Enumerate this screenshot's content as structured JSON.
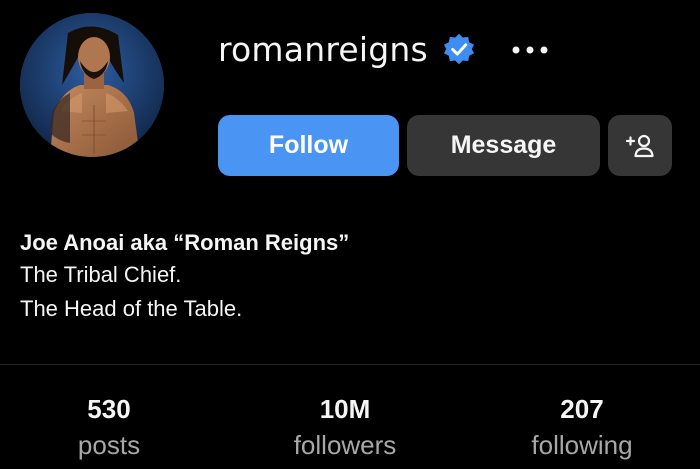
{
  "profile": {
    "username": "romanreigns",
    "verified": true,
    "avatar_icon": "profile-photo",
    "more_icon": "more-options-icon"
  },
  "actions": {
    "follow_label": "Follow",
    "message_label": "Message",
    "suggest_icon": "add-person-icon"
  },
  "bio": {
    "name": "Joe Anoai aka “Roman Reigns”",
    "lines": [
      "The Tribal Chief.",
      "The Head of the Table."
    ]
  },
  "stats": [
    {
      "value": "530",
      "label": "posts"
    },
    {
      "value": "10M",
      "label": "followers"
    },
    {
      "value": "207",
      "label": "following"
    }
  ],
  "colors": {
    "background": "#000000",
    "follow_button": "#4a95f4",
    "secondary_button": "#363636",
    "verified_badge": "#3d8ef0",
    "muted_text": "#a8a8a8"
  }
}
